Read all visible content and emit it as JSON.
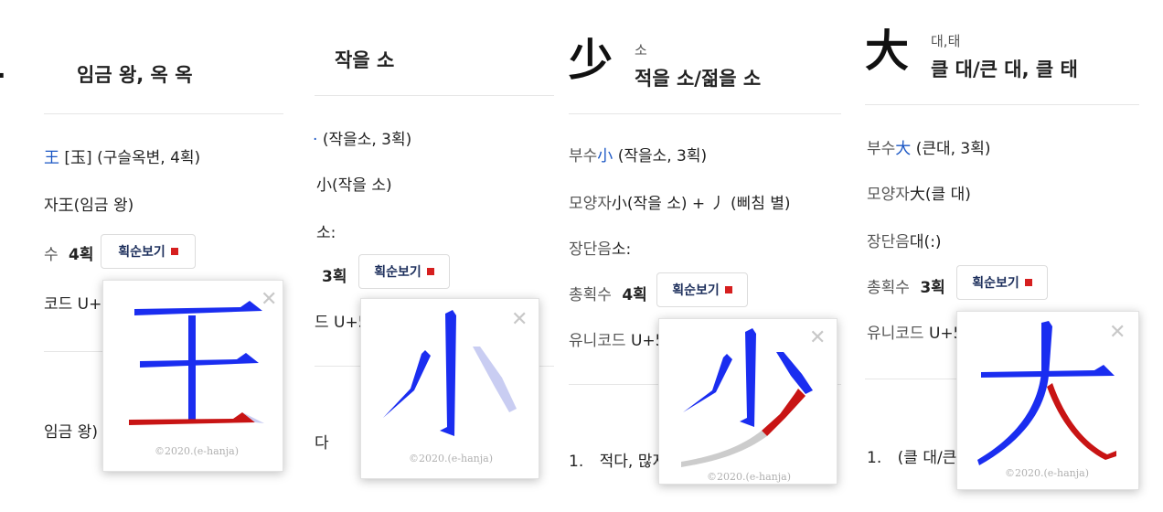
{
  "panels": [
    {
      "hanja": "王",
      "title": "임금 왕, 옥 옥",
      "radical_prefix": "王",
      "radical_rest": "[玉] (구슬옥변, 4획)",
      "shape_row": "자王(임금 왕)",
      "strokes_label": "수",
      "strokes_value": "4획",
      "unicode_row": "코드 U+7",
      "meaning_row": "임금 왕)"
    },
    {
      "title": "작을 소",
      "radical_rest": "(작을소, 3획)",
      "shape_row": "小(작을 소)",
      "long_short_row": "소:",
      "strokes_value": "3획",
      "unicode_row": "드 U+5",
      "meaning_row": "다"
    },
    {
      "hanja": "少",
      "reading": "소",
      "title": "적을 소/젊을 소",
      "radical_label": "부수",
      "radical_char": "小",
      "radical_rest": "(작을소, 3획)",
      "shape_label": "모양자",
      "shape_value": "小(작을 소) + 丿 (삐침 별)",
      "long_short_label": "장단음",
      "long_short_value": "소:",
      "strokes_label": "총획수",
      "strokes_value": "4획",
      "unicode_label": "유니코드",
      "unicode_value": "U+5",
      "meaning_num": "1.",
      "meaning_text": "적다, 많지"
    },
    {
      "hanja": "大",
      "reading": "대,태",
      "title": "클 대/큰 대, 클 태",
      "radical_label": "부수",
      "radical_char": "大",
      "radical_rest": "(큰대, 3획)",
      "shape_label": "모양자",
      "shape_value": "大(클 대)",
      "long_short_label": "장단음",
      "long_short_value": "대(:)",
      "strokes_label": "총획수",
      "strokes_value": "3획",
      "unicode_label": "유니코드",
      "unicode_value": "U+5",
      "meaning_num": "1.",
      "meaning_text": "(클 대/큰"
    }
  ],
  "stroke_button_label": "획순보기",
  "popup_copyright": "©2020.(e-hanja)",
  "colors": {
    "stroke_done": "#1a2df0",
    "stroke_current": "#c81414",
    "stroke_pending": "#c9cdf2",
    "stroke_guide": "#cccccc",
    "link_blue": "#1a56c4",
    "button_square": "#d61f1f"
  },
  "icons": {
    "close": "close-icon",
    "stroke_indicator": "red-square-icon"
  }
}
